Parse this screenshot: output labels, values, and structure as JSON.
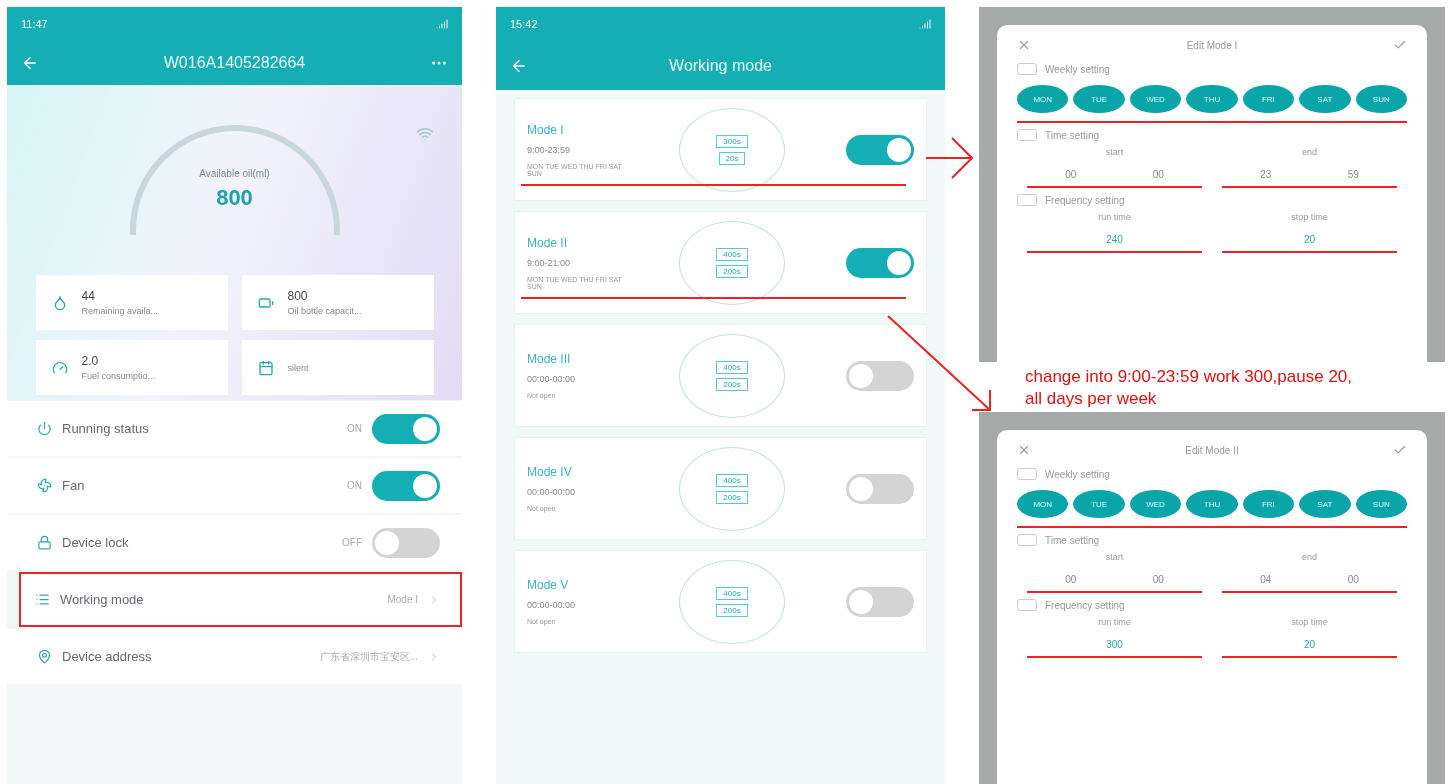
{
  "device_screen": {
    "status_time": "11:47",
    "title": "W016A1405282664",
    "gauge": {
      "label": "Available oil(ml)",
      "value": "800"
    },
    "stats": [
      {
        "kind": "oil",
        "value": "44",
        "label": "Remaining availa..."
      },
      {
        "kind": "bottle",
        "value": "800",
        "label": "Oil bottle capacit..."
      },
      {
        "kind": "fuel",
        "value": "2.0",
        "label": "Fuel consumptio..."
      },
      {
        "kind": "level",
        "label": "silent"
      }
    ],
    "settings": [
      {
        "kind": "power",
        "label": "Running status",
        "state": "ON",
        "on": true,
        "highlighted": false
      },
      {
        "kind": "fan",
        "label": "Fan",
        "state": "ON",
        "on": true,
        "highlighted": false
      },
      {
        "kind": "lock",
        "label": "Device lock",
        "state": "OFF",
        "on": false,
        "highlighted": false
      },
      {
        "kind": "mode",
        "label": "Working mode",
        "value": "Mode I",
        "highlighted": true
      },
      {
        "kind": "address",
        "label": "Device address",
        "value": "广东省深圳市宝安区...",
        "highlighted": false
      }
    ]
  },
  "modes_screen": {
    "status_time": "15:42",
    "title": "Working mode",
    "modes": [
      {
        "name": "Mode I",
        "time": "9:00-23:59",
        "days": "MON TUE WED THU FRI SAT SUN",
        "run": "300s",
        "stop": "20s",
        "on": true,
        "underlined": true
      },
      {
        "name": "Mode II",
        "time": "9:00-21:00",
        "days": "MON TUE WED THU FRI SAT SUN",
        "run": "400s",
        "stop": "200s",
        "on": true,
        "underlined": true
      },
      {
        "name": "Mode III",
        "time": "00:00-00:00",
        "days": "Not open",
        "run": "400s",
        "stop": "200s",
        "on": false,
        "underlined": false
      },
      {
        "name": "Mode IV",
        "time": "00:00-00:00",
        "days": "Not open",
        "run": "400s",
        "stop": "200s",
        "on": false,
        "underlined": false
      },
      {
        "name": "Mode V",
        "time": "00:00-00:00",
        "days": "Not open",
        "run": "400s",
        "stop": "200s",
        "on": false,
        "underlined": false
      }
    ]
  },
  "dialogs": [
    {
      "title": "Edit Mode I",
      "weekly_checked": false,
      "time_checked": false,
      "frequency_checked": false,
      "weekly_label": "Weekly setting",
      "days": [
        {
          "label": "MON",
          "selected": true
        },
        {
          "label": "TUE",
          "selected": true
        },
        {
          "label": "WED",
          "selected": true
        },
        {
          "label": "THU",
          "selected": true
        },
        {
          "label": "FRI",
          "selected": true
        },
        {
          "label": "SAT",
          "selected": true
        },
        {
          "label": "SUN",
          "selected": true
        }
      ],
      "time_label": "Time setting",
      "start_label": "start",
      "end_label": "end",
      "start": [
        "00",
        "00"
      ],
      "end": [
        "23",
        "59"
      ],
      "frequency_label": "Frequency setting",
      "run_label": "run time",
      "stop_label": "stop time",
      "run": "240",
      "stop": "20"
    },
    {
      "title": "Edit Mode II",
      "weekly_checked": false,
      "time_checked": false,
      "frequency_checked": false,
      "weekly_label": "Weekly setting",
      "days": [
        {
          "label": "MON",
          "selected": true
        },
        {
          "label": "TUE",
          "selected": true
        },
        {
          "label": "WED",
          "selected": true
        },
        {
          "label": "THU",
          "selected": true
        },
        {
          "label": "FRI",
          "selected": true
        },
        {
          "label": "SAT",
          "selected": true
        },
        {
          "label": "SUN",
          "selected": true
        }
      ],
      "time_label": "Time setting",
      "start_label": "start",
      "end_label": "end",
      "start": [
        "00",
        "00"
      ],
      "end": [
        "04",
        "00"
      ],
      "frequency_label": "Frequency setting",
      "run_label": "run time",
      "stop_label": "stop time",
      "run": "300",
      "stop": "20"
    }
  ],
  "note": "change into 9:00-23:59 work 300,pause 20,\nall days per week"
}
